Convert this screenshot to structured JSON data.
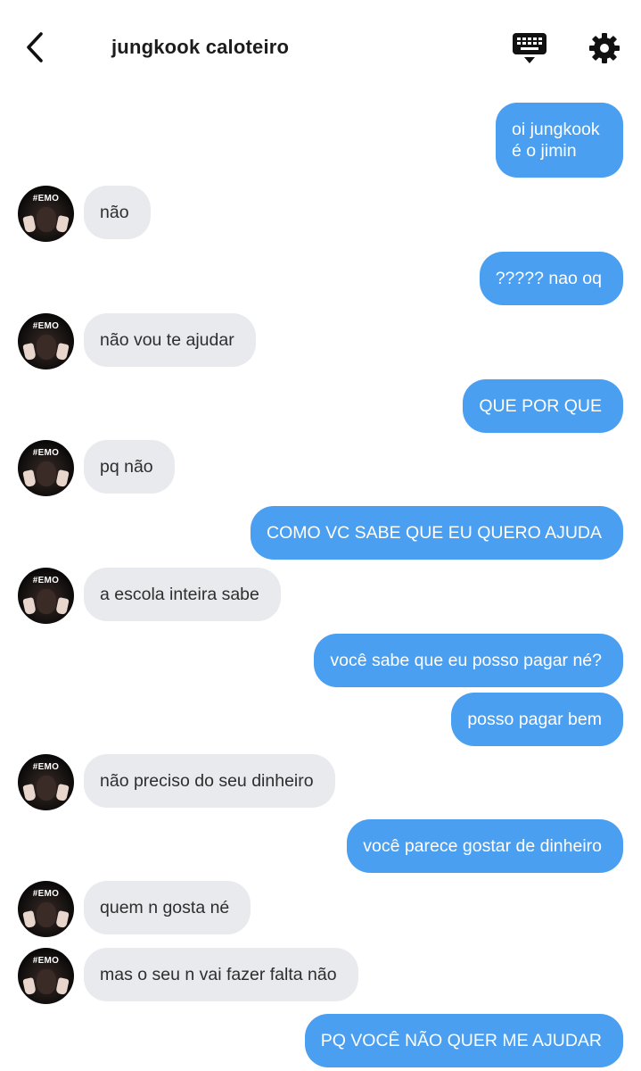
{
  "header": {
    "title": "jungkook caloteiro",
    "back_icon": "chevron-left-icon",
    "keyboard_icon": "keyboard-icon",
    "settings_icon": "gear-icon"
  },
  "contact": {
    "avatar_text": "#EMO"
  },
  "colors": {
    "outgoing_bubble": "#4a9ff0",
    "incoming_bubble": "#e9eaee"
  },
  "messages": [
    {
      "from": "me",
      "text": "oi jungkook é o jimin"
    },
    {
      "from": "them",
      "text": "não"
    },
    {
      "from": "me",
      "text": "????? nao oq"
    },
    {
      "from": "them",
      "text": "não vou te ajudar"
    },
    {
      "from": "me",
      "text": "QUE POR QUE"
    },
    {
      "from": "them",
      "text": "pq não"
    },
    {
      "from": "me",
      "text": "COMO VC SABE QUE EU QUERO AJUDA"
    },
    {
      "from": "them",
      "text": "a escola inteira sabe"
    },
    {
      "from": "me",
      "text": "você sabe que eu posso pagar né?"
    },
    {
      "from": "me",
      "text": "posso pagar bem"
    },
    {
      "from": "them",
      "text": "não preciso do seu dinheiro"
    },
    {
      "from": "me",
      "text": "você parece gostar de dinheiro"
    },
    {
      "from": "them",
      "text": "quem n gosta né"
    },
    {
      "from": "them",
      "text": "mas o seu n vai fazer falta não"
    },
    {
      "from": "me",
      "text": "PQ VOCÊ NÃO QUER ME AJUDAR"
    }
  ]
}
